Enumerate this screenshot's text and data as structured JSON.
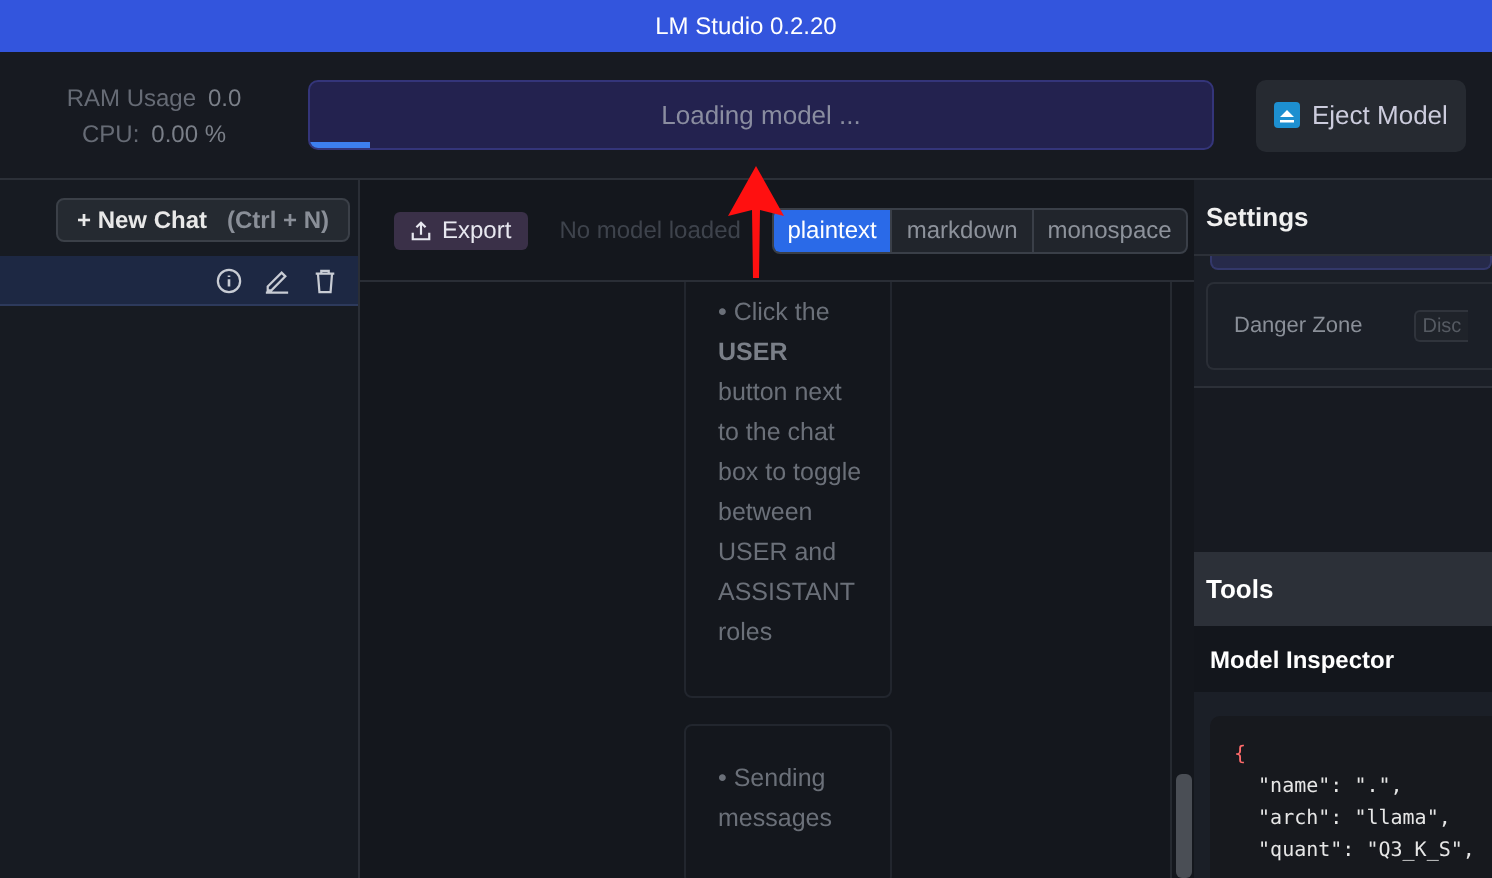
{
  "window": {
    "title": "LM Studio 0.2.20"
  },
  "stats": [
    {
      "label": "RAM Usage",
      "value": "0.0"
    },
    {
      "label": "CPU:",
      "value": "0.00 %"
    }
  ],
  "model_loader": {
    "text": "Loading model ...",
    "level": 0.066
  },
  "eject_button": {
    "label": "Eject Model"
  },
  "sidebar": {
    "new_chat": {
      "label": "+ New Chat",
      "shortcut": "(Ctrl + N)"
    },
    "chats": [
      {
        "selected": true
      }
    ]
  },
  "toolbar": {
    "export": "Export",
    "status": "No model loaded",
    "formats": [
      {
        "label": "plaintext",
        "selected": true
      },
      {
        "label": "markdown",
        "selected": false
      },
      {
        "label": "monospace",
        "selected": false
      }
    ]
  },
  "messages": [
    {
      "text": "• Click the **USER** button next to the chat box to toggle between USER and ASSISTANT roles"
    },
    {
      "text": "• Sending messages"
    }
  ],
  "settings": {
    "title": "Settings",
    "danger_zone": {
      "label": "Danger Zone",
      "button": "Disc"
    }
  },
  "tools": {
    "title": "Tools",
    "inspector": {
      "title": "Model Inspector",
      "code": [
        "{",
        "  \"name\": \".\",",
        "  \"arch\": \"llama\",",
        "  \"quant\": \"Q3_K_S\","
      ]
    }
  }
}
